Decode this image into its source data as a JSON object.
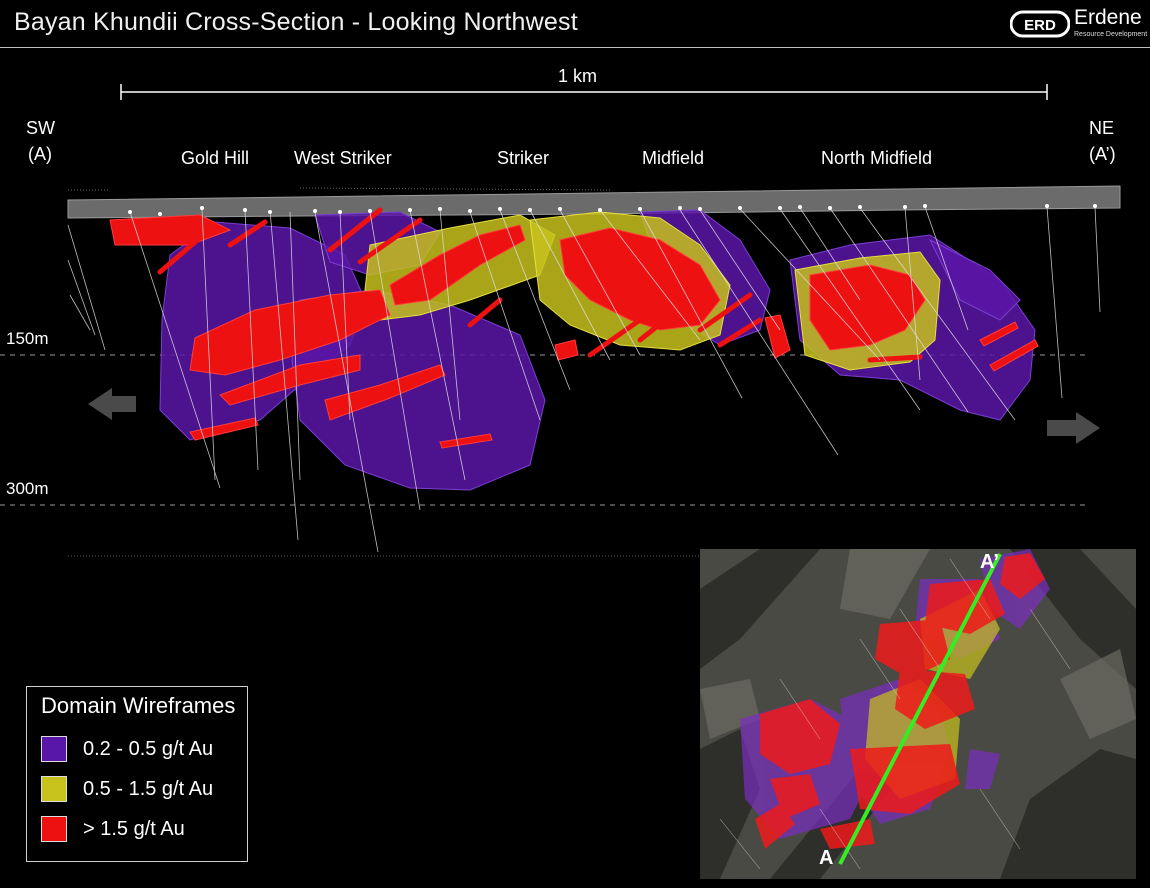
{
  "title": "Bayan Khundii Cross-Section - Looking Northwest",
  "logo": {
    "name": "Erdene",
    "subtitle": "Resource Development",
    "mark": "ERD"
  },
  "scale_bar": {
    "label": "1 km"
  },
  "ends": {
    "sw": {
      "dir": "SW",
      "code": "(A)"
    },
    "ne": {
      "dir": "NE",
      "code": "(A’)"
    }
  },
  "zones": [
    "Gold Hill",
    "West Striker",
    "Striker",
    "Midfield",
    "North Midfield"
  ],
  "depths": [
    "150m",
    "300m"
  ],
  "legend": {
    "title": "Domain Wireframes",
    "items": [
      {
        "label": "0.2 - 0.5 g/t Au",
        "color": "#5a16a8"
      },
      {
        "label": "0.5 - 1.5 g/t Au",
        "color": "#c8c21c"
      },
      {
        "label": "> 1.5 g/t Au",
        "color": "#ee1111"
      }
    ]
  },
  "inset_map": {
    "start_label": "A",
    "end_label": "A’",
    "line_color": "#33ee22"
  },
  "colors": {
    "low_grade": "#5a16a8",
    "mid_grade": "#c8c21c",
    "high_grade": "#ee1111",
    "drillhole": "#e8e8e8",
    "arrow": "#4a4a4a"
  }
}
